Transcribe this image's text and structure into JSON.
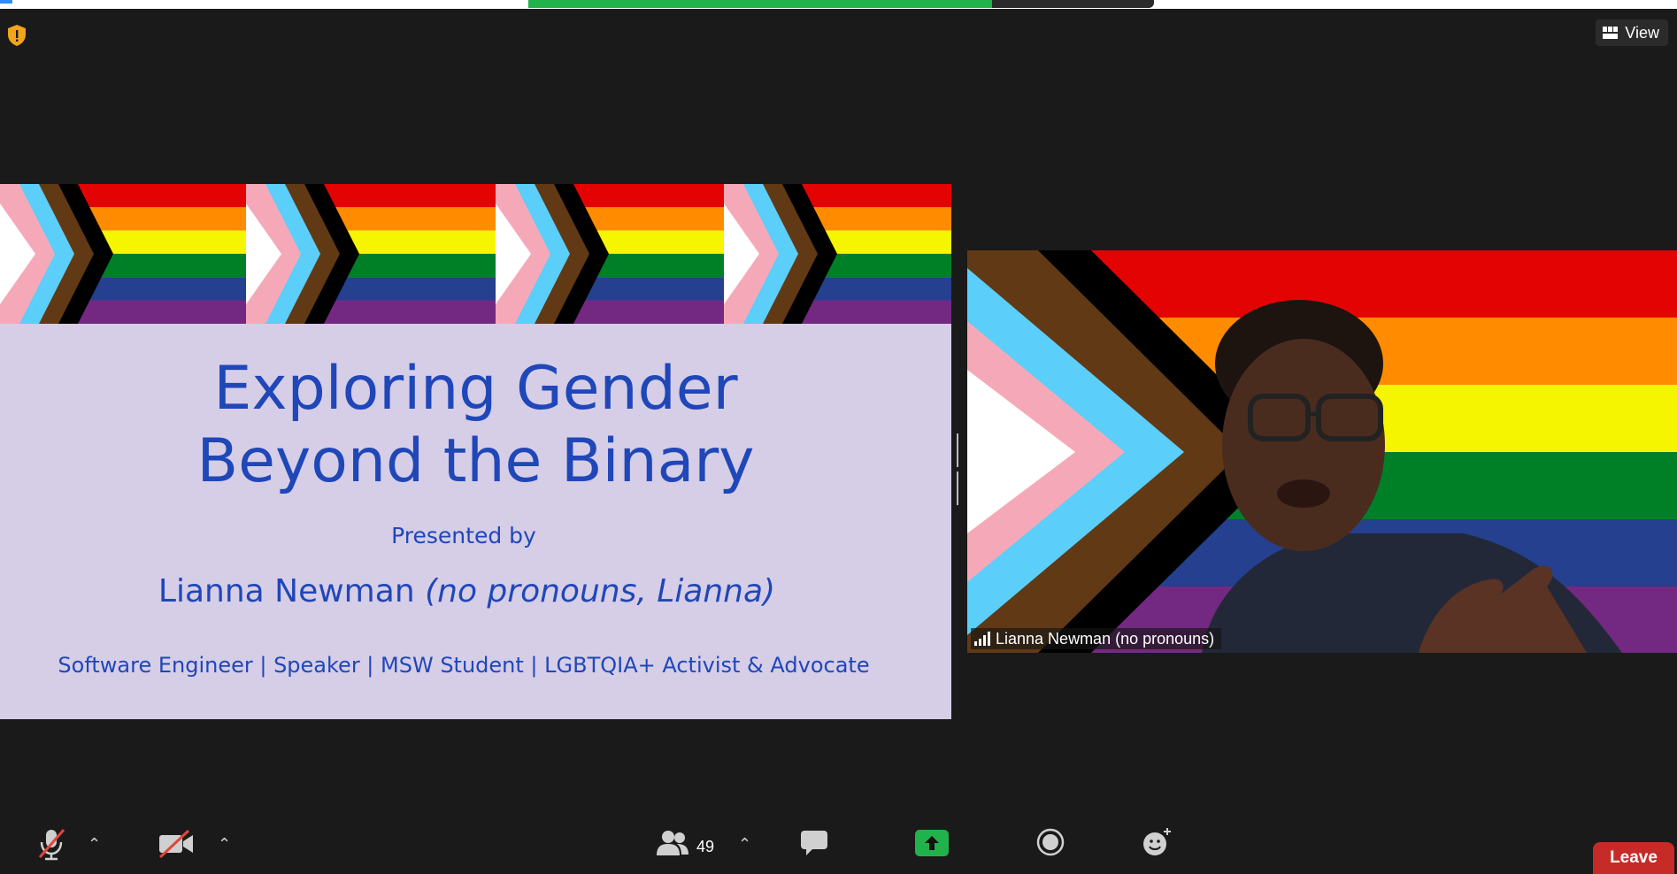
{
  "meeting": {
    "view_label": "View"
  },
  "slide": {
    "title_line1": "Exploring Gender",
    "title_line2": "Beyond the Binary",
    "presented_by": "Presented by",
    "presenter_name": "Lianna Newman",
    "presenter_pronouns": "(no pronouns, Lianna)",
    "roles": "Software Engineer | Speaker | MSW Student | LGBTQIA+ Activist & Advocate"
  },
  "video": {
    "participant_name": "Lianna Newman (no pronouns)"
  },
  "toolbar": {
    "participants_count": "49",
    "leave_label": "Leave"
  },
  "colors": {
    "slide_bg": "#d6cde7",
    "slide_text": "#1f47b8",
    "leave_red": "#c62b28",
    "share_green": "#22b24c",
    "mute_red": "#e0463c"
  }
}
